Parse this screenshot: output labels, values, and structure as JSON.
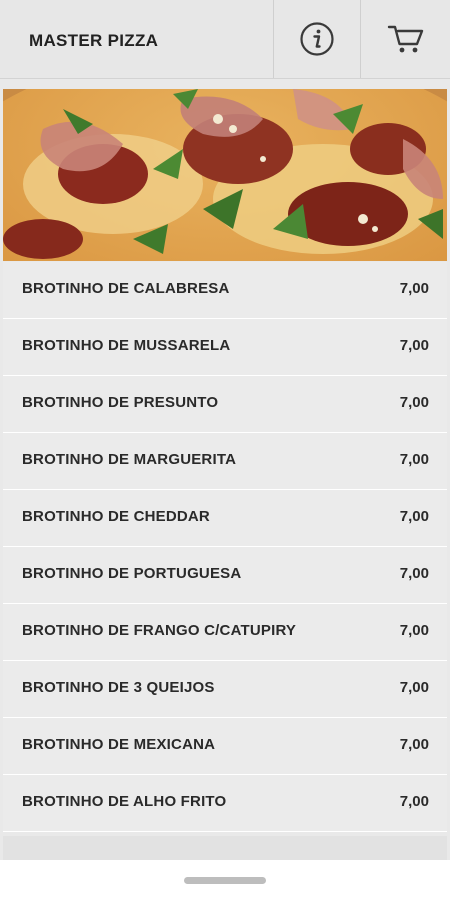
{
  "header": {
    "title": "MASTER PIZZA",
    "info_icon": "info-icon",
    "cart_icon": "cart-icon"
  },
  "hero": {
    "image": "pizza-photo"
  },
  "menu": {
    "items": [
      {
        "name": "BROTINHO DE CALABRESA",
        "price": "7,00"
      },
      {
        "name": "BROTINHO DE MUSSARELA",
        "price": "7,00"
      },
      {
        "name": "BROTINHO DE PRESUNTO",
        "price": "7,00"
      },
      {
        "name": "BROTINHO DE MARGUERITA",
        "price": "7,00"
      },
      {
        "name": "BROTINHO DE CHEDDAR",
        "price": "7,00"
      },
      {
        "name": "BROTINHO DE PORTUGUESA",
        "price": "7,00"
      },
      {
        "name": "BROTINHO DE FRANGO C/CATUPIRY",
        "price": "7,00"
      },
      {
        "name": "BROTINHO DE 3 QUEIJOS",
        "price": "7,00"
      },
      {
        "name": "BROTINHO DE MEXICANA",
        "price": "7,00"
      },
      {
        "name": "BROTINHO DE ALHO FRITO",
        "price": "7,00"
      }
    ]
  },
  "colors": {
    "header_bg": "#e7e7e7",
    "row_bg": "#ebebeb",
    "text": "#2a2a2a"
  }
}
